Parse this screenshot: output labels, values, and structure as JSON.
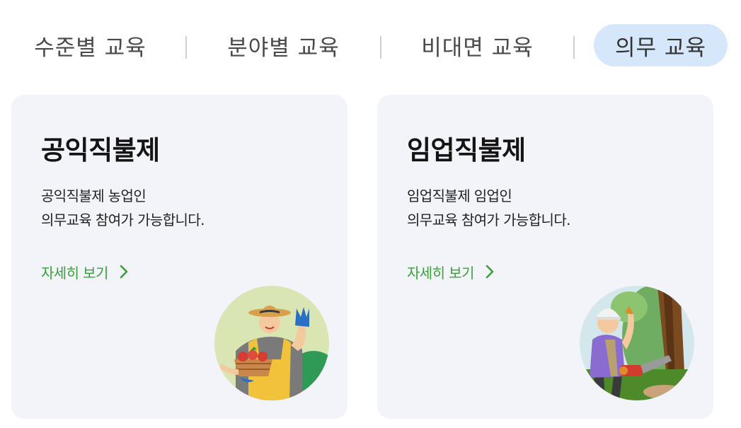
{
  "tabs": [
    {
      "label": "수준별 교육",
      "active": false
    },
    {
      "label": "분야별 교육",
      "active": false
    },
    {
      "label": "비대면 교육",
      "active": false
    },
    {
      "label": "의무 교육",
      "active": true
    }
  ],
  "colors": {
    "active_tab_bg": "#d6e6fb",
    "card_bg": "#f3f4f9",
    "link": "#3aa13a",
    "title": "#141414"
  },
  "cards": [
    {
      "title": "공익직불제",
      "desc_line1": "공익직불제 농업인",
      "desc_line2": "의무교육 참여가 가능합니다.",
      "link": "자세히 보기",
      "link_icon": "chevron-right-icon",
      "illustration": "farmer-with-apple-basket"
    },
    {
      "title": "임업직불제",
      "desc_line1": "임업직불제 임업인",
      "desc_line2": "의무교육 참여가 가능합니다.",
      "link": "자세히 보기",
      "link_icon": "chevron-right-icon",
      "illustration": "forester-with-chainsaw"
    }
  ]
}
